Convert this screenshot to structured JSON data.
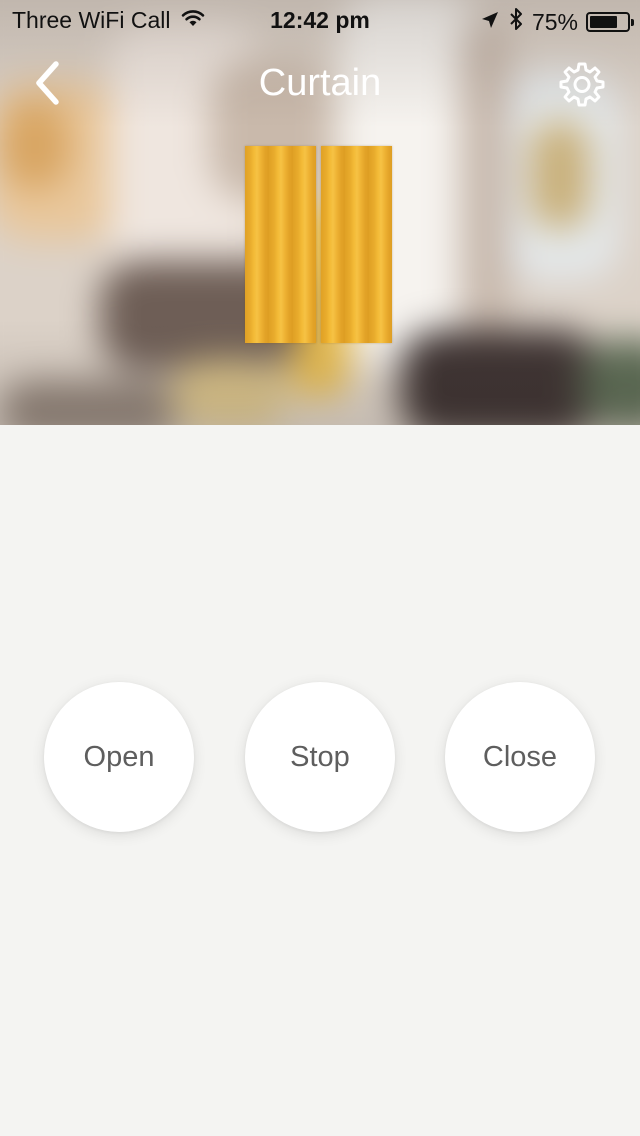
{
  "status_bar": {
    "carrier": "Three WiFi Call",
    "time": "12:42 pm",
    "battery_percent": "75%",
    "battery_level": 0.75,
    "icons": [
      "wifi-icon",
      "location-arrow-icon",
      "bluetooth-icon",
      "battery-icon"
    ]
  },
  "nav": {
    "title": "Curtain",
    "back_icon": "chevron-left-icon",
    "settings_icon": "gear-icon"
  },
  "device": {
    "illustration": "curtain-icon",
    "curtain_color": "#f0b22f"
  },
  "controls": {
    "open_label": "Open",
    "stop_label": "Stop",
    "close_label": "Close"
  },
  "colors": {
    "page_background": "#f4f4f2",
    "button_background": "#ffffff",
    "button_text": "#5e5e5e",
    "title_text": "#ffffff"
  }
}
